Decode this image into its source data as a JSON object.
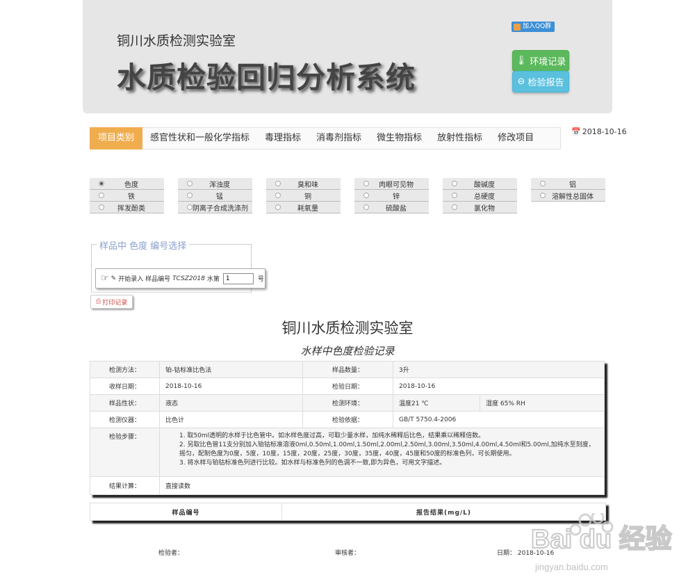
{
  "header": {
    "lab_name": "铜川水质检测实验室",
    "system_title": "水质检验回归分析系统",
    "qq_button": "加入QQ群",
    "env_button": "环境记录",
    "report_button": "检验报告"
  },
  "nav": {
    "items": [
      "项目类别",
      "感官性状和一般化学指标",
      "毒理指标",
      "消毒剂指标",
      "微生物指标",
      "放射性指标",
      "修改项目"
    ],
    "date": "2018-10-16"
  },
  "radios": [
    [
      "色度",
      "铁",
      "挥发酚类"
    ],
    [
      "浑浊度",
      "锰",
      "阴离子合成洗涤剂"
    ],
    [
      "臭和味",
      "铜",
      "耗氧量"
    ],
    [
      "肉眼可见物",
      "锌",
      "硫酸盐"
    ],
    [
      "酸碱度",
      "总硬度",
      "氯化物"
    ],
    [
      "铝",
      "溶解性总固体"
    ]
  ],
  "selected_radio": "色度",
  "sample": {
    "legend": "样品中 色度 编号选择",
    "prefix": "开始录入 样品编号",
    "code": "TCSZ2018",
    "mid": "水第",
    "number": "1",
    "suffix": "号",
    "print_button": "打印记录"
  },
  "report": {
    "title": "铜川水质检测实验室",
    "subtitle": "水样中色度检验记录",
    "method_label": "检测方法：",
    "method": "铂-钴标准比色法",
    "count_label": "样品数量：",
    "count": "3升",
    "recv_label": "收样日期：",
    "recv_date": "2018-10-16",
    "test_date_label": "检验日期：",
    "test_date": "2018-10-16",
    "prop_label": "样品性状：",
    "prop": "液态",
    "env_label": "检测环境：",
    "temp": "温度21 ℃",
    "humidity": "湿度 65% RH",
    "instrument_label": "检测仪器：",
    "instrument": "比色计",
    "basis_label": "检验依据：",
    "basis": "GB/T 5750.4-2006",
    "steps_label": "检验步骤：",
    "step1": "1. 取50ml透明的水样于比色管中。如水样色度过高，可取少量水样，加纯水稀释后比色，结果乘以稀释倍数。",
    "step2": "2. 另取比色管11支分别加入铂钴标准溶液0ml,0.50ml,1.00ml,1.50ml,2.00ml,2.50ml,3.00ml,3.50ml,4.00ml,4.50ml和5.00ml,加纯水至刻度，摇匀，配制色度为0度，5度，10度，15度，20度，25度，30度，35度，40度，45度和50度的标准色列，可长期使用。",
    "step3": "3. 将水样与铂钴标准色列进行比较。如水样与标准色列的色调不一致,即为异色，可用文字描述。",
    "calc_label": "结果计算：",
    "calc": "直接读数",
    "col_sample": "样品编号",
    "col_result": "报告结果(mg/L)"
  },
  "footer": {
    "tester": "检验者：",
    "reviewer": "审核者：",
    "date": "日期： 2018-10-16"
  },
  "watermark": {
    "brand": "Bai du 经验",
    "url": "jingyan.baidu.com"
  }
}
